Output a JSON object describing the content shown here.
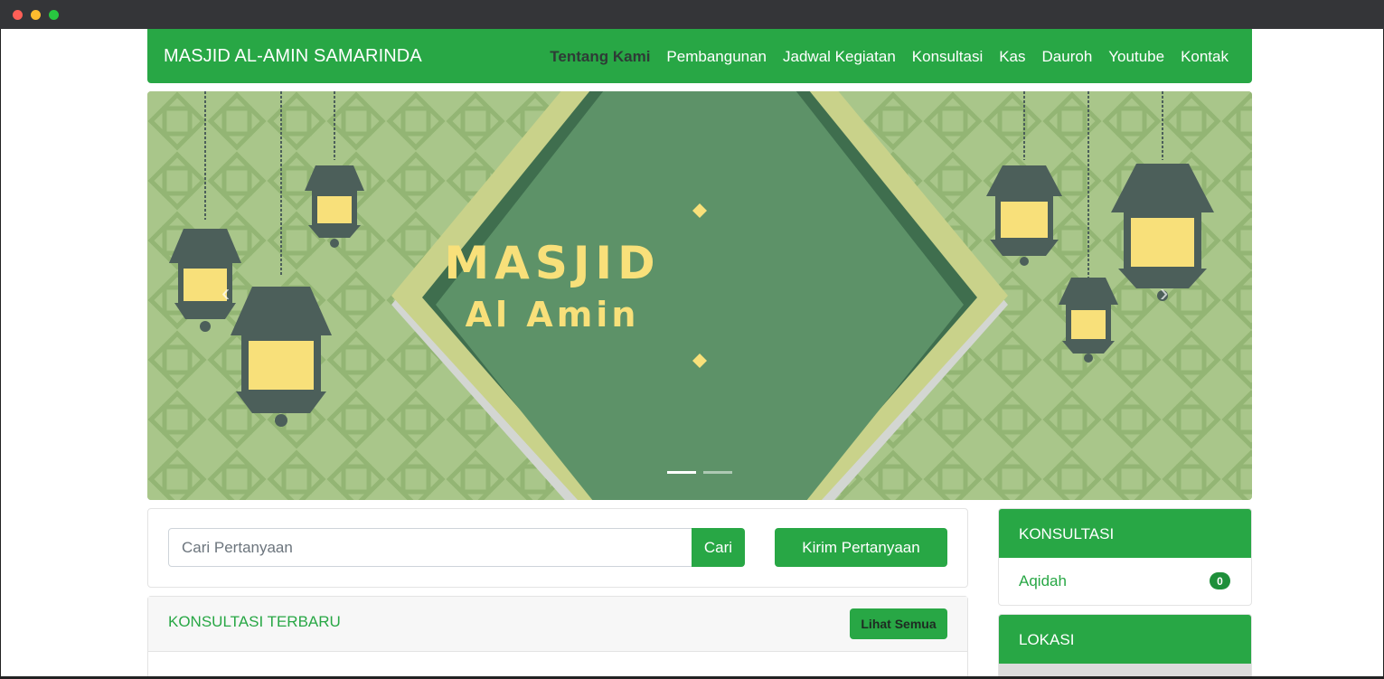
{
  "navbar": {
    "brand": "MASJID AL-AMIN SAMARINDA",
    "items": [
      "Tentang Kami",
      "Pembangunan",
      "Jadwal Kegiatan",
      "Konsultasi",
      "Kas",
      "Dauroh",
      "Youtube",
      "Kontak"
    ],
    "active_index": 0
  },
  "carousel": {
    "title_line1": "MASJID",
    "title_line2": "Al Amin",
    "prev_icon": "chevron-left-icon",
    "next_icon": "chevron-right-icon",
    "slide_count": 2,
    "active_slide": 1
  },
  "search": {
    "placeholder": "Cari Pertanyaan",
    "button_label": "Cari",
    "ask_button_label": "Kirim Pertanyaan"
  },
  "latest": {
    "title": "KONSULTASI TERBARU",
    "button_label": "Lihat Semua"
  },
  "sidebar": {
    "konsultasi": {
      "title": "KONSULTASI",
      "items": [
        {
          "label": "Aqidah",
          "count": "0"
        }
      ]
    },
    "lokasi": {
      "title": "LOKASI"
    }
  },
  "colors": {
    "primary": "#28a745",
    "active_nav": "#2e3b36",
    "hero_text": "#f8e07a",
    "hero_diamond": "#5d9268",
    "hero_bg": "#a9c68a"
  }
}
